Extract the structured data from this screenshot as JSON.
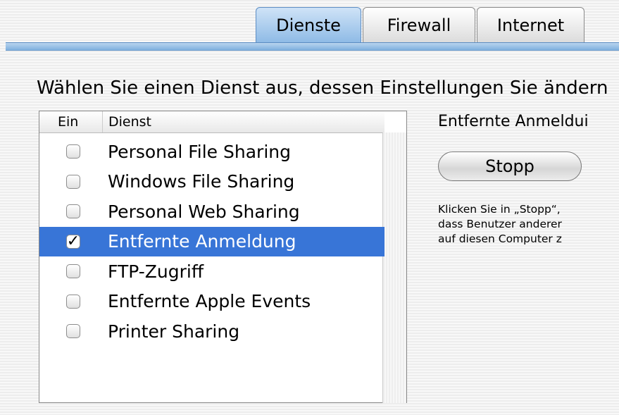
{
  "tabs": [
    "Dienste",
    "Firewall",
    "Internet"
  ],
  "active_tab": "Dienste",
  "instruction": "Wählen Sie einen Dienst aus, dessen Einstellungen Sie ändern",
  "list": {
    "header_ein": "Ein",
    "header_dienst": "Dienst",
    "items": [
      {
        "label": "Personal File Sharing",
        "checked": false
      },
      {
        "label": "Windows File Sharing",
        "checked": false
      },
      {
        "label": "Personal Web Sharing",
        "checked": false
      },
      {
        "label": "Entfernte Anmeldung",
        "checked": true,
        "selected": true
      },
      {
        "label": "FTP-Zugriff",
        "checked": false
      },
      {
        "label": "Entfernte Apple Events",
        "checked": false
      },
      {
        "label": "Printer Sharing",
        "checked": false
      }
    ]
  },
  "right_panel": {
    "title": "Entfernte Anmeldui",
    "button": "Stopp",
    "description": [
      "Klicken Sie in „Stopp“,",
      "dass Benutzer anderer",
      "auf diesen Computer z"
    ]
  },
  "colors": {
    "selection": "#3875d7",
    "tab_active": "#8fbbe6"
  }
}
